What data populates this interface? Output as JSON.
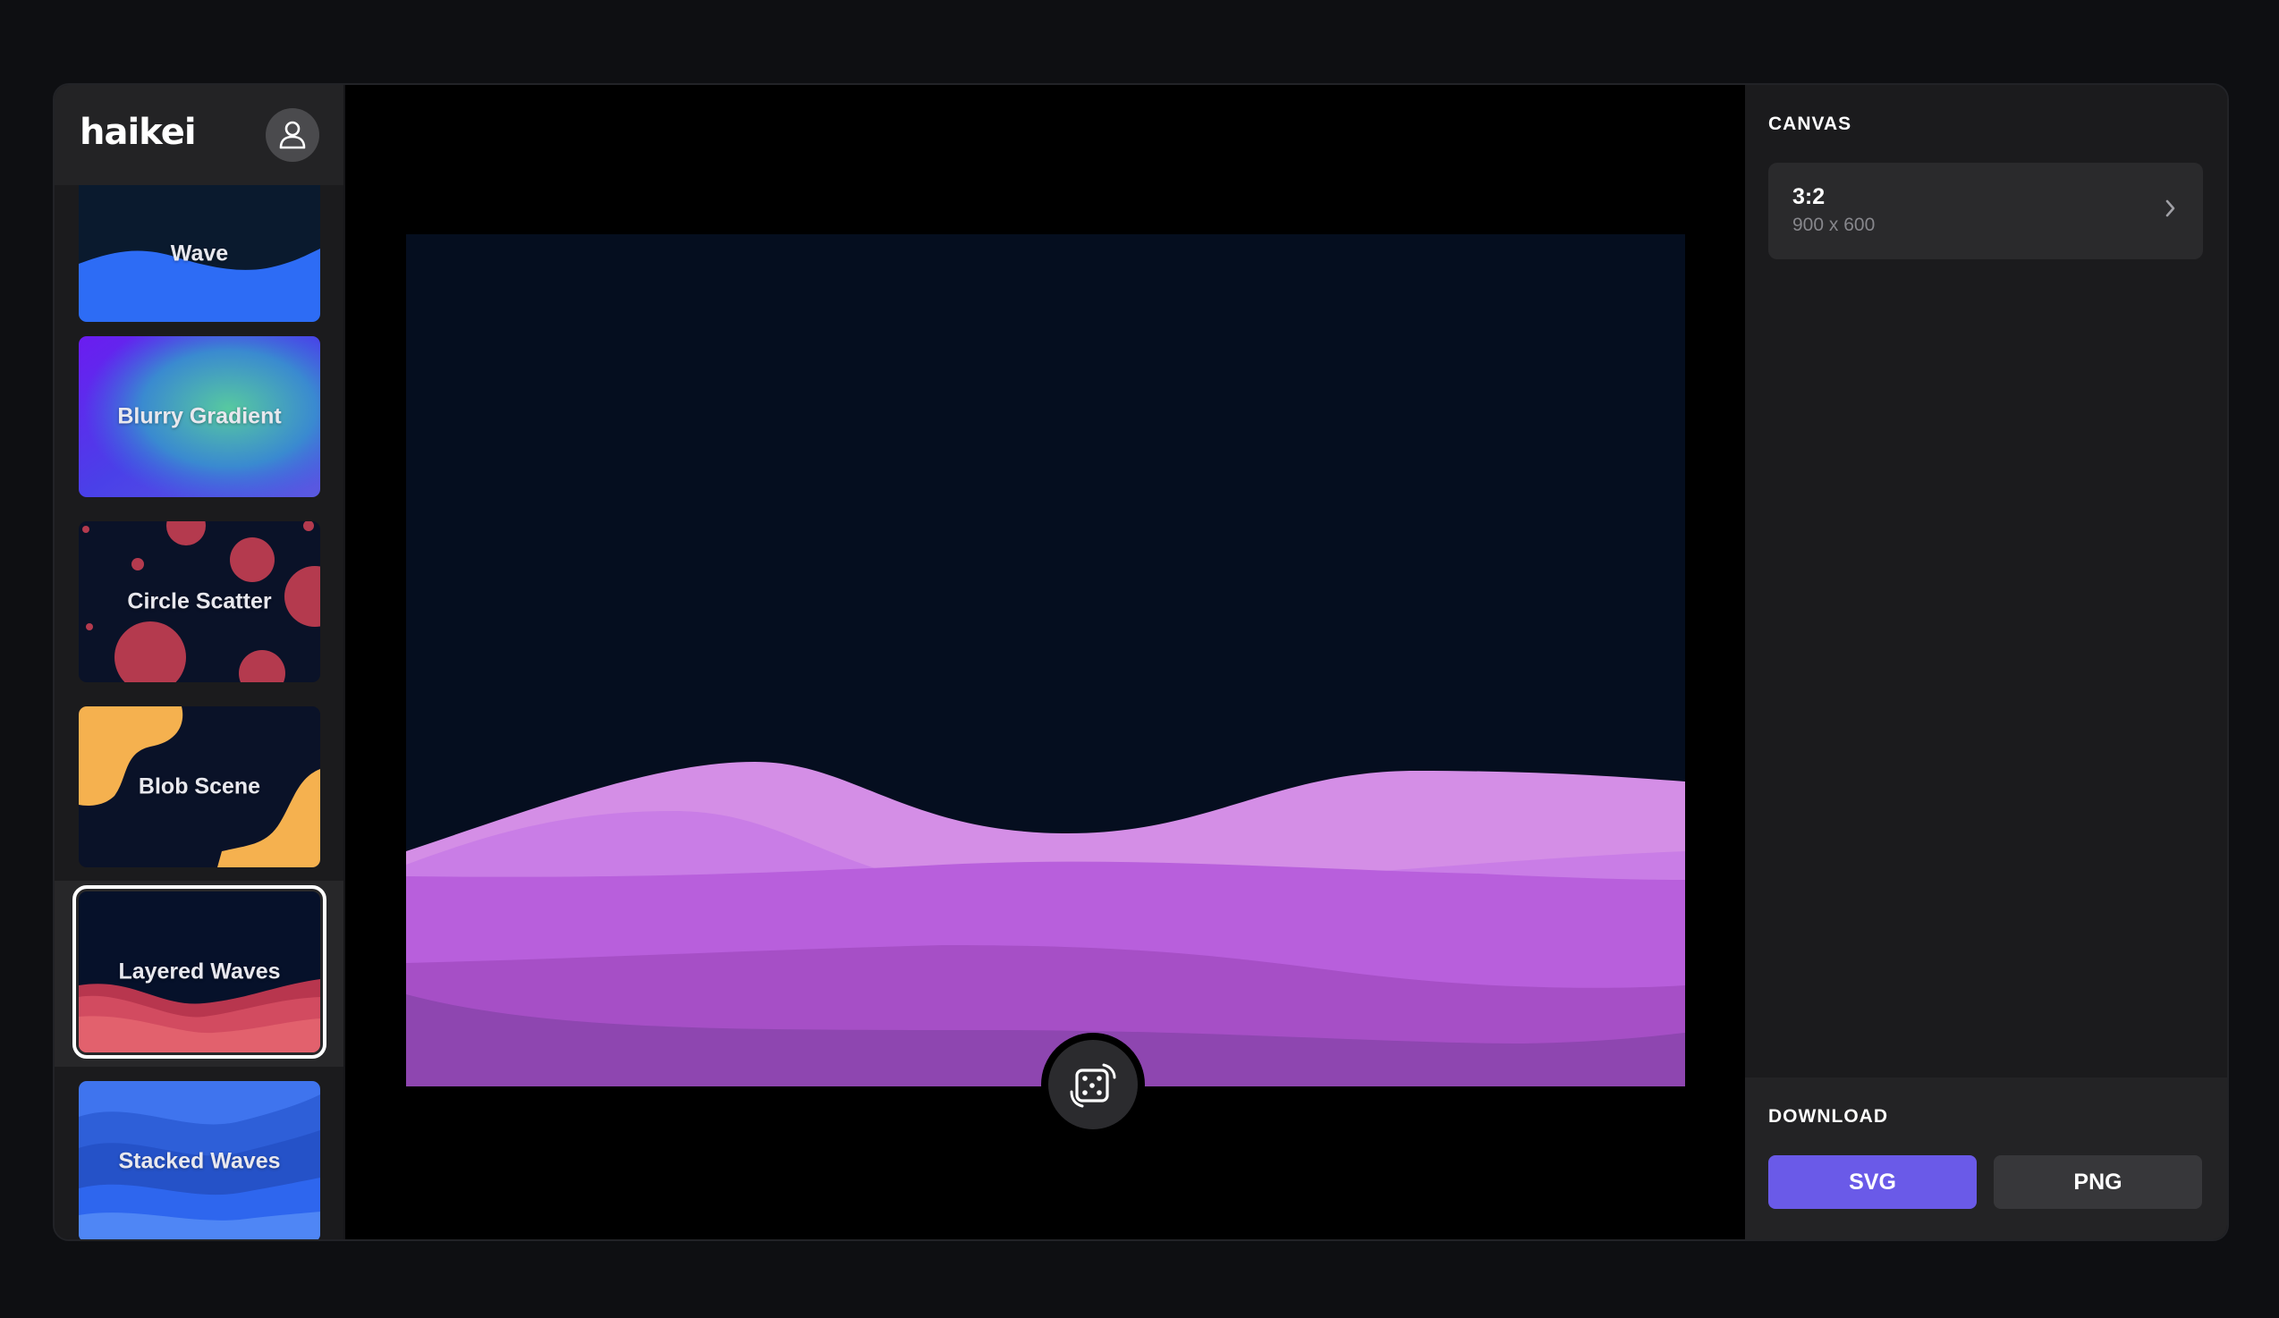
{
  "app": {
    "logo": "haikei"
  },
  "sidebar": {
    "items": [
      {
        "label": "Wave"
      },
      {
        "label": "Blurry Gradient"
      },
      {
        "label": "Circle Scatter"
      },
      {
        "label": "Blob Scene"
      },
      {
        "label": "Layered Waves"
      },
      {
        "label": "Stacked Waves"
      }
    ],
    "selected": "Layered Waves"
  },
  "canvas": {
    "background": "#050e1f",
    "layer_colors": [
      "#d48ee6",
      "#c97de6",
      "#b85fdc",
      "#a64fc6",
      "#8e46b0"
    ]
  },
  "panel": {
    "canvas_title": "CANVAS",
    "ratio": "3:2",
    "dimensions": "900 x 600",
    "download_title": "DOWNLOAD",
    "svg_label": "SVG",
    "png_label": "PNG"
  },
  "colors": {
    "accent": "#6a5ae8"
  }
}
